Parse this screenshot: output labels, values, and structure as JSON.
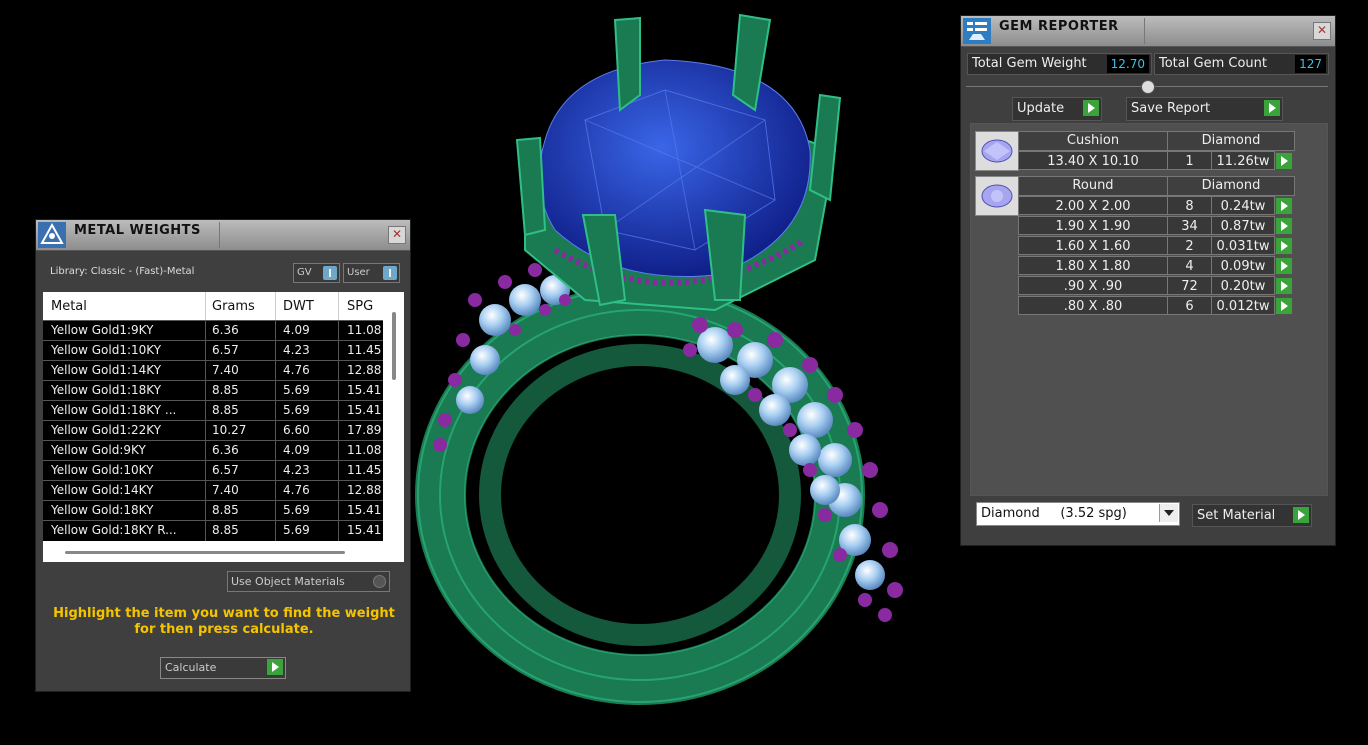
{
  "metal_weights": {
    "title": "METAL WEIGHTS",
    "library_label": "Library: Classic - (Fast)-Metal",
    "toggle_gv": "GV",
    "toggle_user": "User",
    "columns": [
      "Metal",
      "Grams",
      "DWT",
      "SPG"
    ],
    "rows": [
      [
        "Yellow Gold1:9KY",
        "6.36",
        "4.09",
        "11.08"
      ],
      [
        "Yellow Gold1:10KY",
        "6.57",
        "4.23",
        "11.45"
      ],
      [
        "Yellow Gold1:14KY",
        "7.40",
        "4.76",
        "12.88"
      ],
      [
        "Yellow Gold1:18KY",
        "8.85",
        "5.69",
        "15.41"
      ],
      [
        "Yellow Gold1:18KY ...",
        "8.85",
        "5.69",
        "15.41"
      ],
      [
        "Yellow Gold1:22KY",
        "10.27",
        "6.60",
        "17.89"
      ],
      [
        "Yellow Gold:9KY",
        "6.36",
        "4.09",
        "11.08"
      ],
      [
        "Yellow Gold:10KY",
        "6.57",
        "4.23",
        "11.45"
      ],
      [
        "Yellow Gold:14KY",
        "7.40",
        "4.76",
        "12.88"
      ],
      [
        "Yellow Gold:18KY",
        "8.85",
        "5.69",
        "15.41"
      ],
      [
        "Yellow Gold:18KY R...",
        "8.85",
        "5.69",
        "15.41"
      ]
    ],
    "use_object_materials": "Use Object Materials",
    "hint": "Highlight the item you want to find the weight for then press calculate.",
    "calculate_label": "Calculate"
  },
  "gem_reporter": {
    "title": "GEM REPORTER",
    "total_weight_label": "Total Gem Weight",
    "total_weight_value": "12.70",
    "total_count_label": "Total Gem Count",
    "total_count_value": "127",
    "update_label": "Update",
    "save_report_label": "Save Report",
    "groups": [
      {
        "shape": "Cushion",
        "material": "Diamond",
        "rows": [
          [
            "13.40 X 10.10",
            "1",
            "11.26tw"
          ]
        ]
      },
      {
        "shape": "Round",
        "material": "Diamond",
        "rows": [
          [
            "2.00 X 2.00",
            "8",
            "0.24tw"
          ],
          [
            "1.90 X 1.90",
            "34",
            "0.87tw"
          ],
          [
            "1.60 X 1.60",
            "2",
            "0.031tw"
          ],
          [
            "1.80 X 1.80",
            "4",
            "0.09tw"
          ],
          [
            ".90 X .90",
            "72",
            "0.20tw"
          ],
          [
            ".80 X .80",
            "6",
            "0.012tw"
          ]
        ]
      }
    ],
    "material_select": "Diamond     (3.52 spg)",
    "set_material_label": "Set Material"
  },
  "colors": {
    "metal": "#1e8a5e",
    "center_stone": "#1f3fb8",
    "accent_stones": "#8a2aa0",
    "diamonds": "#b8d8f5",
    "hint_text": "#f5c400",
    "value_text": "#3cc0e8"
  }
}
